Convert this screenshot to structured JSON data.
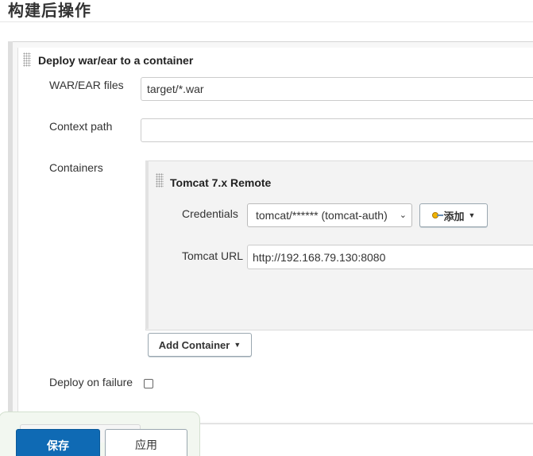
{
  "section": {
    "title": "构建后操作"
  },
  "step": {
    "title": "Deploy war/ear to a container",
    "war_ear_label": "WAR/EAR files",
    "war_ear_value": "target/*.war",
    "context_path_label": "Context path",
    "context_path_value": "",
    "containers_label": "Containers",
    "deploy_on_failure_label": "Deploy on failure",
    "deploy_on_failure_checked": false,
    "add_container_label": "Add Container"
  },
  "container": {
    "title": "Tomcat 7.x Remote",
    "credentials_label": "Credentials",
    "credentials_selected": "tomcat/****** (tomcat-auth)",
    "add_credentials_label": "添加",
    "tomcat_url_label": "Tomcat URL",
    "tomcat_url_value": "http://192.168.79.130:8080"
  },
  "footer": {
    "save_label": "保存",
    "apply_label": "应用"
  },
  "icons": {
    "drag_handle": "drag-handle-icon",
    "key": "key-icon",
    "dropdown": "caret-down-icon"
  },
  "colors": {
    "primary_button": "#0f6ab4",
    "panel_background": "#f7f7f7",
    "container_background": "#f3f3f3"
  }
}
